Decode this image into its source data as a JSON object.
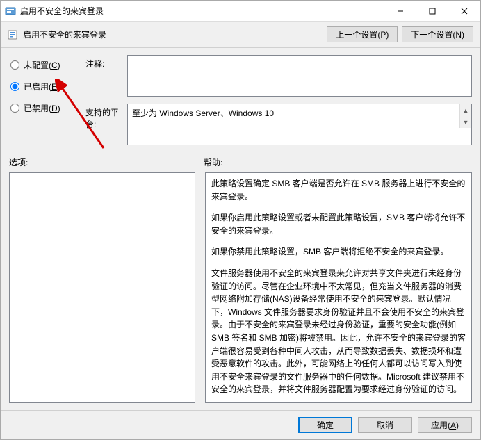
{
  "titlebar": {
    "title": "启用不安全的来宾登录"
  },
  "subheader": {
    "title": "启用不安全的来宾登录",
    "prev": "上一个设置(P)",
    "next": "下一个设置(N)"
  },
  "radios": {
    "not_configured": "未配置(C)",
    "enabled": "已启用(E)",
    "disabled": "已禁用(D)",
    "selected": "enabled"
  },
  "fields": {
    "comment_label": "注释:",
    "comment_value": "",
    "platform_label": "支持的平台:",
    "platform_value": "至少为 Windows Server、Windows 10"
  },
  "labels": {
    "options": "选项:",
    "help": "帮助:"
  },
  "help_paragraphs": [
    "此策略设置确定 SMB 客户端是否允许在 SMB 服务器上进行不安全的来宾登录。",
    "如果你启用此策略设置或者未配置此策略设置，SMB 客户端将允许不安全的来宾登录。",
    "如果你禁用此策略设置，SMB 客户端将拒绝不安全的来宾登录。",
    "文件服务器使用不安全的来宾登录来允许对共享文件夹进行未经身份验证的访问。尽管在企业环境中不太常见，但充当文件服务器的消费型网络附加存储(NAS)设备经常使用不安全的来宾登录。默认情况下，Windows 文件服务器要求身份验证并且不会使用不安全的来宾登录。由于不安全的来宾登录未经过身份验证，重要的安全功能(例如 SMB 签名和 SMB 加密)将被禁用。因此，允许不安全的来宾登录的客户端很容易受到各种中间人攻击，从而导致数据丢失、数据损坏和遭受恶意软件的攻击。此外，可能网络上的任何人都可以访问写入到使用不安全来宾登录的文件服务器中的任何数据。Microsoft 建议禁用不安全的来宾登录，并将文件服务器配置为要求经过身份验证的访问。"
  ],
  "footer": {
    "ok": "确定",
    "cancel": "取消",
    "apply": "应用(A)"
  }
}
